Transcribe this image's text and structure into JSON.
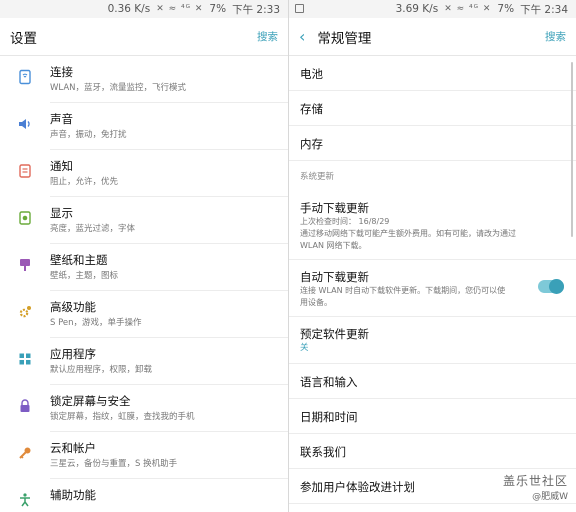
{
  "left": {
    "status": {
      "speed": "0.36 K/s",
      "icons": "✕ ≈ ⁴ᴳ ✕",
      "battery": "7%",
      "time": "下午 2:33"
    },
    "header": {
      "title": "设置",
      "search": "搜索"
    },
    "items": [
      {
        "title": "连接",
        "sub": "WLAN，蓝牙，流量监控，飞行模式",
        "icon": "connections-icon",
        "color": "#4a90d9"
      },
      {
        "title": "声音",
        "sub": "声音，振动，免打扰",
        "icon": "sound-icon",
        "color": "#4a7fd4"
      },
      {
        "title": "通知",
        "sub": "阻止，允许，优先",
        "icon": "notifications-icon",
        "color": "#e06a5a"
      },
      {
        "title": "显示",
        "sub": "亮度，蓝光过滤，字体",
        "icon": "display-icon",
        "color": "#6aaa3a"
      },
      {
        "title": "壁纸和主题",
        "sub": "壁纸，主题，图标",
        "icon": "wallpaper-icon",
        "color": "#9b59b6"
      },
      {
        "title": "高级功能",
        "sub": "S Pen，游戏，单手操作",
        "icon": "advanced-features-icon",
        "color": "#d4a02a"
      },
      {
        "title": "应用程序",
        "sub": "默认应用程序，权限，卸载",
        "icon": "apps-icon",
        "color": "#3aa0b8"
      },
      {
        "title": "锁定屏幕与安全",
        "sub": "锁定屏幕，指纹，虹膜，查找我的手机",
        "icon": "lock-icon",
        "color": "#7d5cc4"
      },
      {
        "title": "云和帐户",
        "sub": "三星云，备份与重置，S 换机助手",
        "icon": "cloud-key-icon",
        "color": "#e08a3a"
      },
      {
        "title": "辅助功能",
        "sub": "",
        "icon": "accessibility-icon",
        "color": "#3aa06a"
      }
    ]
  },
  "right": {
    "status": {
      "speed": "3.69 K/s",
      "icons": "✕ ≈ ⁴ᴳ ✕",
      "battery": "7%",
      "time": "下午 2:34"
    },
    "header": {
      "title": "常规管理",
      "search": "搜索"
    },
    "battery": "电池",
    "storage": "存储",
    "memory": "内存",
    "section": "系统更新",
    "manual": {
      "title": "手动下载更新",
      "line1": "上次检查时间： 16/8/29",
      "line2": "通过移动网络下载可能产生额外费用。如有可能，请改为通过",
      "line3": "WLAN 网络下载。"
    },
    "auto": {
      "title": "自动下载更新",
      "line1": "连接 WLAN 时自动下载软件更新。下载期间，您仍可以使",
      "line2": "用设备。",
      "enabled": true
    },
    "scheduled": {
      "title": "预定软件更新",
      "value": "关"
    },
    "language": "语言和输入",
    "datetime": "日期和时间",
    "contact": "联系我们",
    "ux": "参加用户体验改进计划"
  },
  "watermark": {
    "line1": "盖乐世社区",
    "line2": "@肥威W"
  }
}
